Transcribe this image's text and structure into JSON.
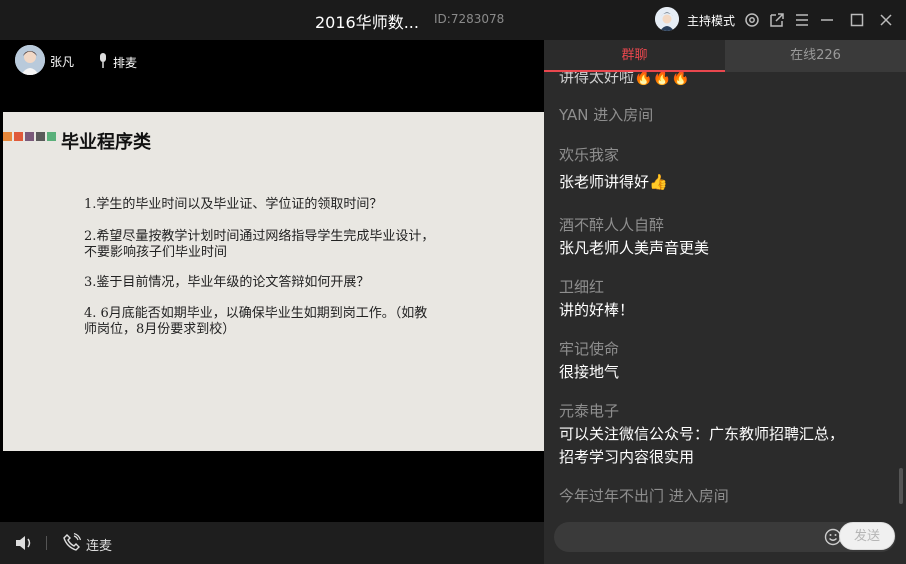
{
  "titlebar": {
    "title": "2016华师数...",
    "room_id": "ID:7283078",
    "host_mode": "主持模式"
  },
  "video": {
    "presenter_name": "张凡",
    "queue_label": "排麦"
  },
  "slide": {
    "title": "毕业程序类",
    "bar_colors": [
      "#e8883a",
      "#e05a3a",
      "#7a5a7a",
      "#5a5a5a",
      "#5ab07a"
    ],
    "questions": [
      [
        "1.学生的毕业时间以及毕业证、学位证的领取时间？"
      ],
      [
        "2.希望尽量按教学计划时间通过网络指导学生完成毕业设计，",
        "不要影响孩子们毕业时间"
      ],
      [
        "3.鉴于目前情况，毕业年级的论文答辩如何开展？"
      ],
      [
        "4. 6月底能否如期毕业，以确保毕业生如期到岗工作。（如教",
        "师岗位，8月份要求到校）"
      ]
    ]
  },
  "controls": {
    "link_mic": "连麦"
  },
  "chat": {
    "tabs": {
      "group": "群聊",
      "online": "在线226"
    },
    "partial_top": "讲得太好啦",
    "messages": [
      {
        "system": "YAN 进入房间"
      },
      {
        "name": "欢乐我家",
        "text": "张老师讲得好👍"
      },
      {
        "name": "酒不醉人人自醉",
        "text": "张凡老师人美声音更美"
      },
      {
        "name": "卫细红",
        "text": "讲的好棒！"
      },
      {
        "name": "牢记使命",
        "text": "很接地气"
      },
      {
        "name": "元泰电子",
        "text": "可以关注微信公众号：广东教师招聘汇总，",
        "text2": "招考学习内容很实用"
      },
      {
        "system": "今年过年不出门 进入房间"
      }
    ],
    "input_placeholder": "",
    "send_label": "发送"
  },
  "colors": {
    "accent": "#e9474e"
  }
}
